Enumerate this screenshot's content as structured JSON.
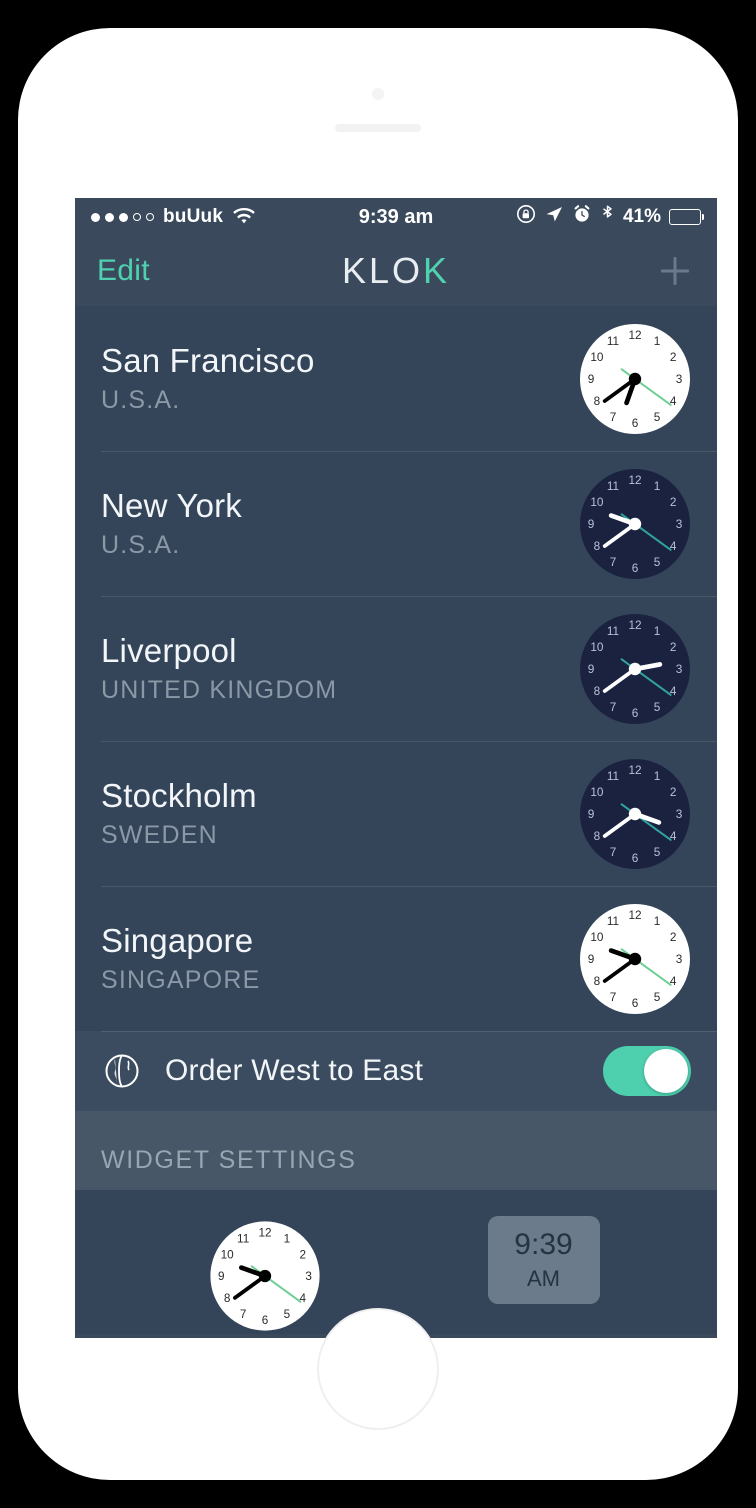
{
  "status_bar": {
    "signal_dots_filled": 3,
    "signal_dots_total": 5,
    "carrier": "buUuk",
    "wifi_icon": "wifi-icon",
    "time": "9:39 am",
    "rotation_lock_icon": "rotation-lock-icon",
    "location_icon": "location-arrow-icon",
    "alarm_icon": "alarm-clock-icon",
    "bluetooth_icon": "bluetooth-icon",
    "battery_percent": "41%",
    "battery_level": 41
  },
  "nav": {
    "edit_label": "Edit",
    "title_main": "KLO",
    "title_accent": "K",
    "add_icon": "plus-icon"
  },
  "cities": [
    {
      "name": "San Francisco",
      "country": "U.S.A.",
      "face": "light",
      "hour": 6,
      "minute": 39,
      "second": 21,
      "clock_label": "6:39"
    },
    {
      "name": "New York",
      "country": "U.S.A.",
      "face": "dark",
      "hour": 9,
      "minute": 39,
      "second": 21,
      "clock_label": "9:39"
    },
    {
      "name": "Liverpool",
      "country": "UNITED KINGDOM",
      "face": "dark",
      "hour": 2,
      "minute": 39,
      "second": 21,
      "clock_label": "2:39"
    },
    {
      "name": "Stockholm",
      "country": "SWEDEN",
      "face": "dark",
      "hour": 3,
      "minute": 39,
      "second": 21,
      "clock_label": "3:39"
    },
    {
      "name": "Singapore",
      "country": "SINGAPORE",
      "face": "light",
      "hour": 9,
      "minute": 39,
      "second": 21,
      "clock_label": "9:39"
    }
  ],
  "order_toggle": {
    "icon": "globe-icon",
    "label": "Order West to East",
    "state": "on"
  },
  "widget_settings": {
    "header": "WIDGET SETTINGS",
    "analog_option": {
      "icon": "analog-clock-icon",
      "hour": 9,
      "minute": 39,
      "second": 21,
      "selected": false
    },
    "digital_option": {
      "time": "9:39",
      "ampm": "AM",
      "selected": true
    }
  },
  "colors": {
    "accent_teal": "#4fd1b0",
    "screen_bg": "#3a4a5c",
    "list_bg": "#34455a",
    "section_bg": "#475767",
    "dark_face": "#1b2240",
    "light_face": "#ffffff",
    "tile_bg": "#6b7b8c"
  },
  "hardware": {
    "home_button": "home-button",
    "speaker": "earpiece-speaker",
    "camera": "front-camera"
  }
}
